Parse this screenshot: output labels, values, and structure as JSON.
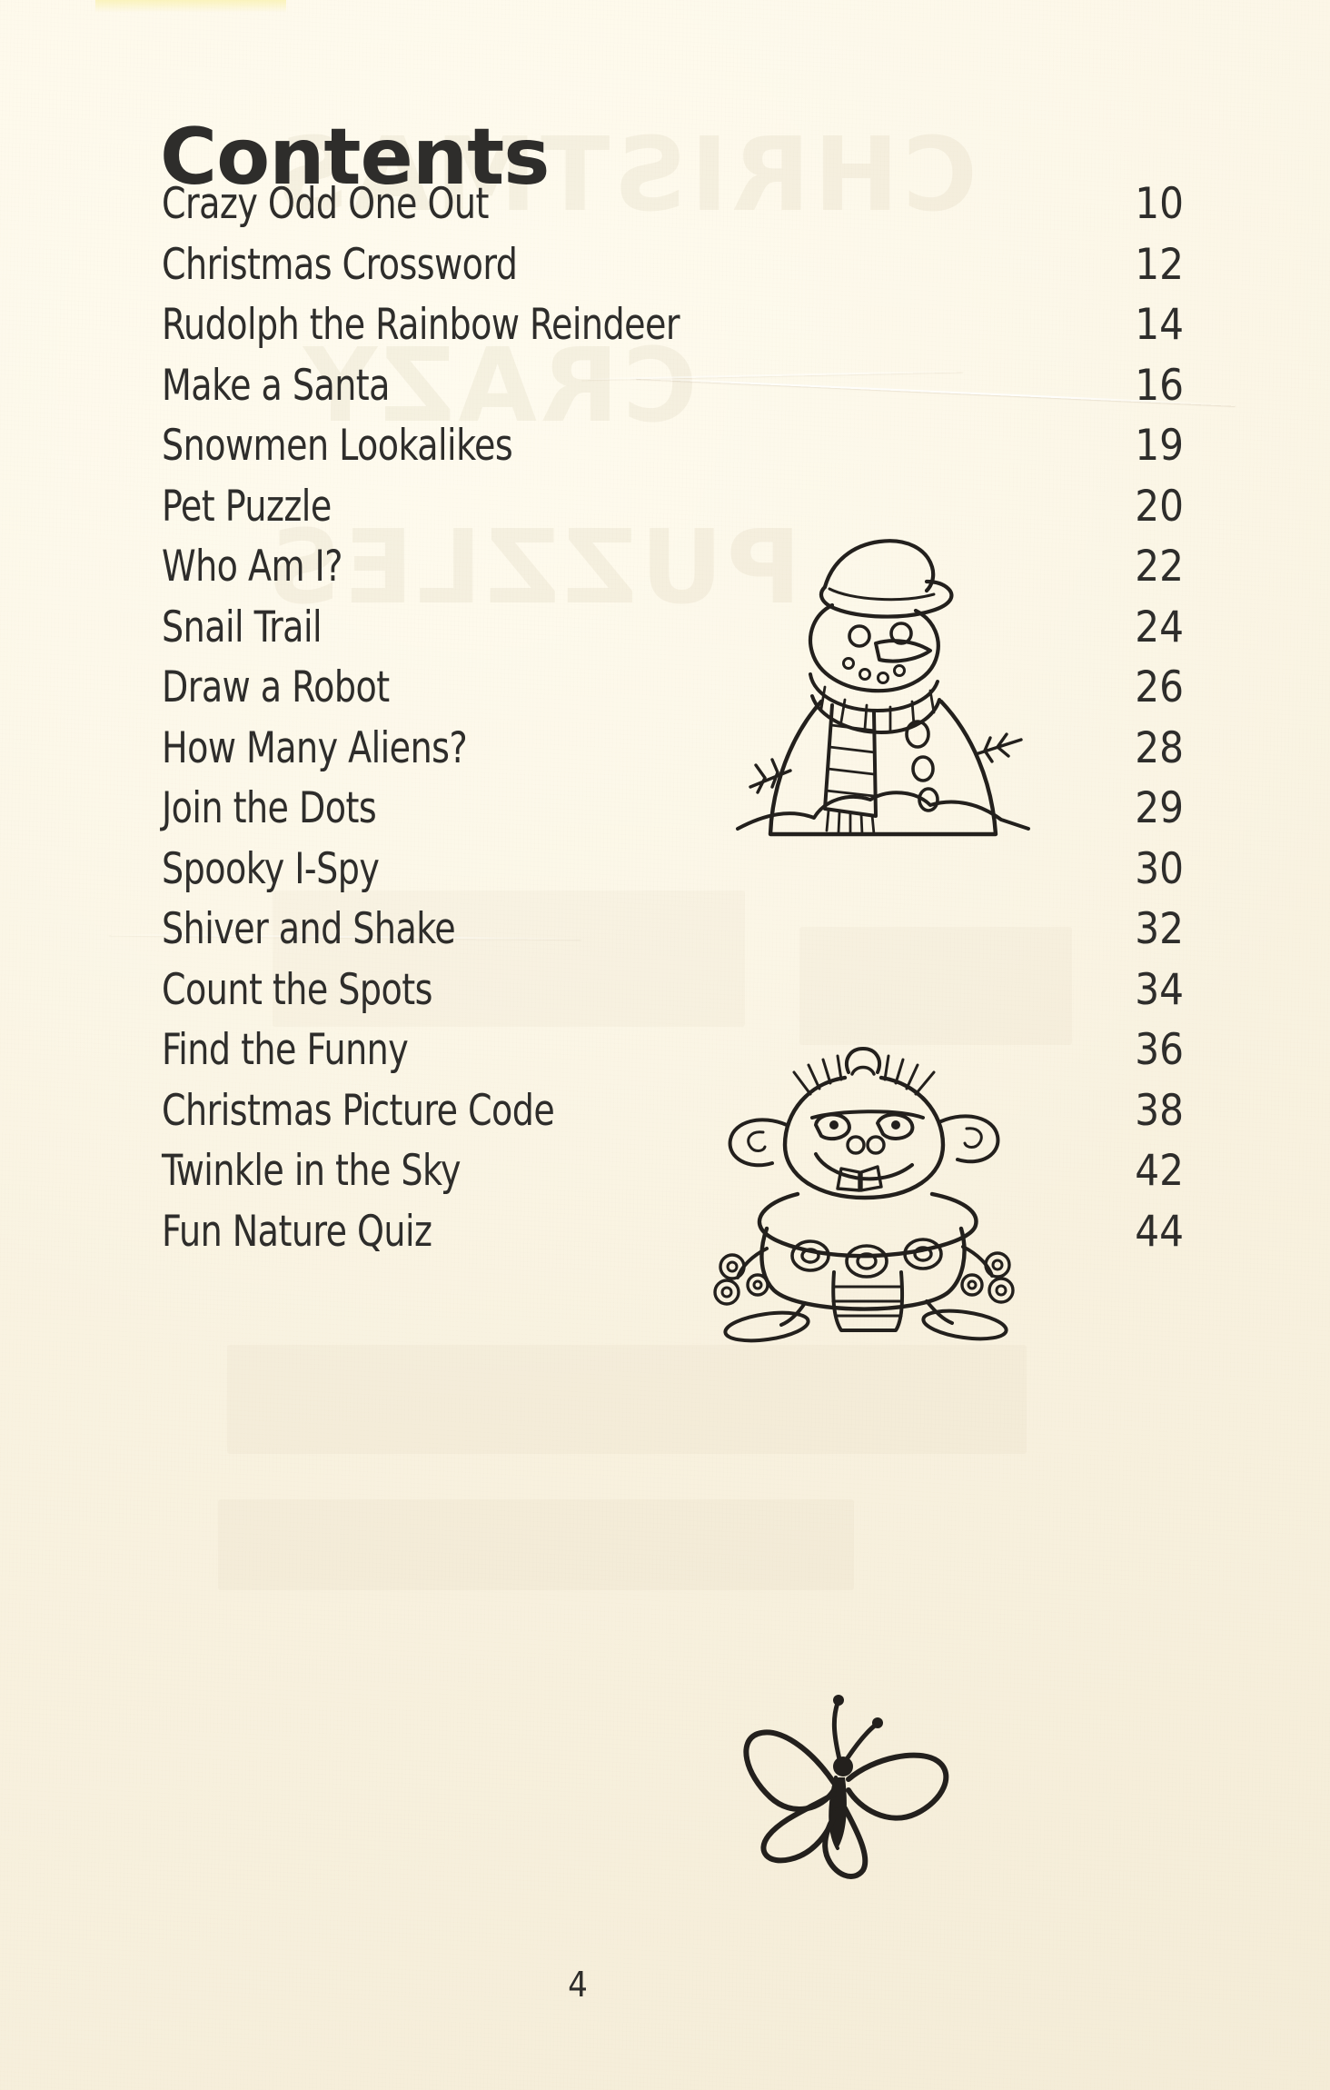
{
  "page": {
    "title": "Contents",
    "folio": "4",
    "background_color": "#fbf5e6",
    "ink_color": "#2e2d2b"
  },
  "contents": {
    "heading": "Contents",
    "entries": [
      {
        "title": "Crazy Odd One Out",
        "page": "10"
      },
      {
        "title": "Christmas Crossword",
        "page": "12"
      },
      {
        "title": "Rudolph the Rainbow Reindeer",
        "page": "14"
      },
      {
        "title": "Make a Santa",
        "page": "16"
      },
      {
        "title": "Snowmen Lookalikes",
        "page": "19"
      },
      {
        "title": "Pet Puzzle",
        "page": "20"
      },
      {
        "title": "Who Am I?",
        "page": "22"
      },
      {
        "title": "Snail Trail",
        "page": "24"
      },
      {
        "title": "Draw a Robot",
        "page": "26"
      },
      {
        "title": "How Many Aliens?",
        "page": "28"
      },
      {
        "title": "Join the Dots",
        "page": "29"
      },
      {
        "title": "Spooky I-Spy",
        "page": "30"
      },
      {
        "title": "Shiver and Shake",
        "page": "32"
      },
      {
        "title": "Count the Spots",
        "page": "34"
      },
      {
        "title": "Find the Funny",
        "page": "36"
      },
      {
        "title": "Christmas Picture Code",
        "page": "38"
      },
      {
        "title": "Twinkle in the Sky",
        "page": "42"
      },
      {
        "title": "Fun Nature Quiz",
        "page": "44"
      }
    ]
  },
  "illustrations": [
    {
      "name": "snowman-illustration",
      "description": "Line-drawn snowman with bowler hat, striped scarf, carrot nose, coal buttons and twig arms"
    },
    {
      "name": "alien-illustration",
      "description": "Cartoon alien with large ears, eyelashes, buck teeth, striped body and spiral hands"
    },
    {
      "name": "butterfly-illustration",
      "description": "Simple line-drawn butterfly with two pairs of wings and antennae"
    }
  ],
  "ghost_text": [
    "CHRISTMAS",
    "CRAZY",
    "PUZZLES"
  ]
}
